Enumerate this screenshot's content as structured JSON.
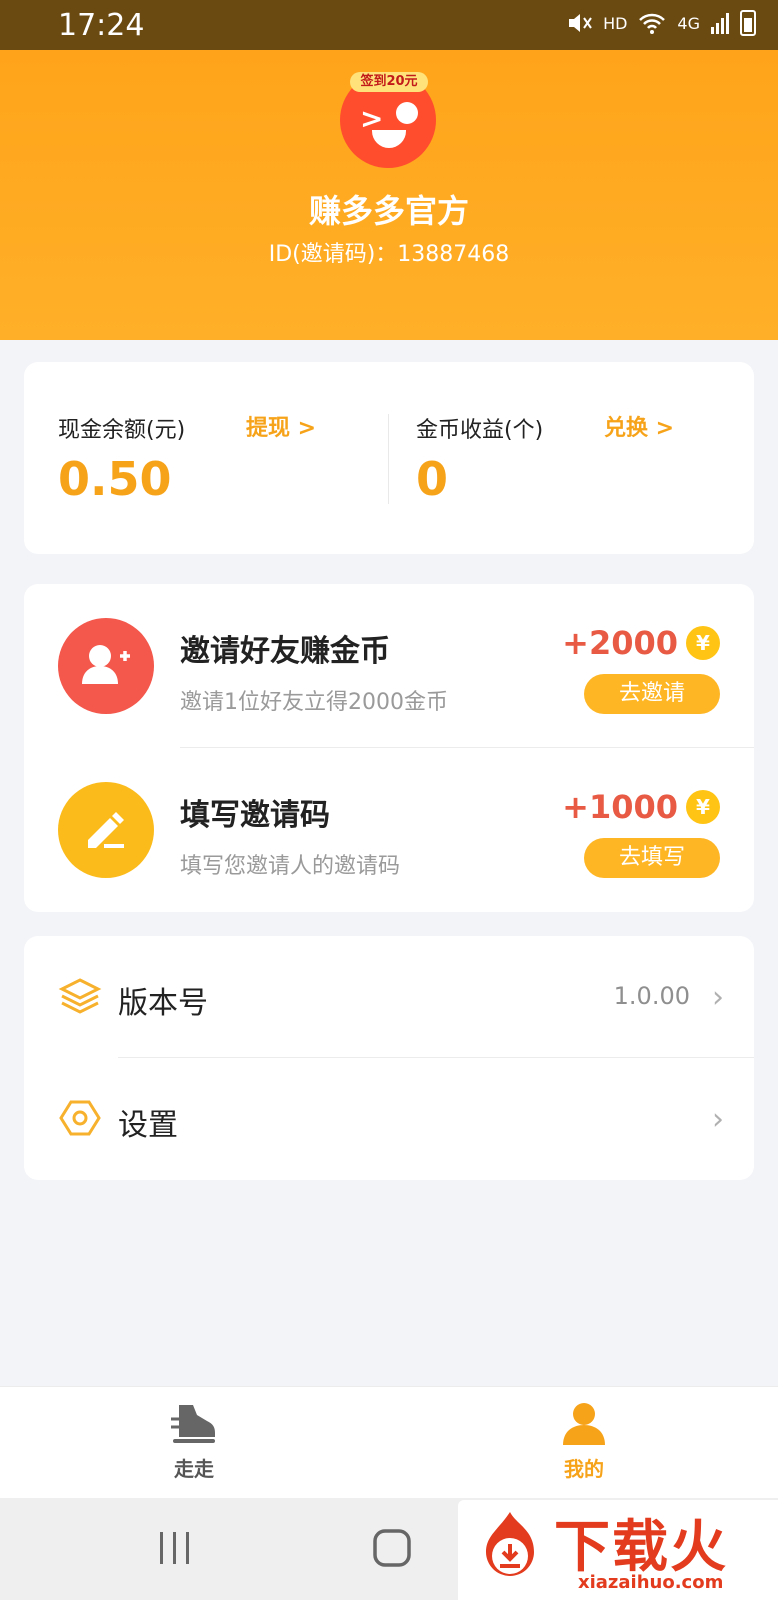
{
  "status_bar": {
    "time": "17:24",
    "hd": "HD",
    "network": "4G"
  },
  "profile": {
    "badge": "签到20元",
    "name": "赚多多官方",
    "id_text": "ID(邀请码)：13887468"
  },
  "balance": {
    "cash_label": "现金余额(元)",
    "cash_action": "提现 >",
    "cash_value": "0.50",
    "coin_label": "金币收益(个)",
    "coin_action": "兑换 >",
    "coin_value": "0"
  },
  "tasks": [
    {
      "title": "邀请好友赚金币",
      "desc": "邀请1位好友立得2000金币",
      "reward": "+2000",
      "coin": "¥",
      "button": "去邀请",
      "icon": "add-user-icon",
      "color": "#f4574b"
    },
    {
      "title": "填写邀请码",
      "desc": "填写您邀请人的邀请码",
      "reward": "+1000",
      "coin": "¥",
      "button": "去填写",
      "icon": "pencil-icon",
      "color": "#fbbb1b"
    }
  ],
  "settings": [
    {
      "label": "版本号",
      "value": "1.0.00",
      "icon": "layers-icon"
    },
    {
      "label": "设置",
      "value": "",
      "icon": "hexagon-icon"
    }
  ],
  "tabbar": [
    {
      "label": "走走",
      "icon": "shoe-icon",
      "color": "#555555"
    },
    {
      "label": "我的",
      "icon": "person-icon",
      "color": "#f7a31a"
    }
  ],
  "watermark": {
    "title": "下载火",
    "url": "xiazaihuo.com"
  },
  "colors": {
    "header": "#ffa41a",
    "accent": "#f7a31a",
    "reward": "#e85a44"
  }
}
